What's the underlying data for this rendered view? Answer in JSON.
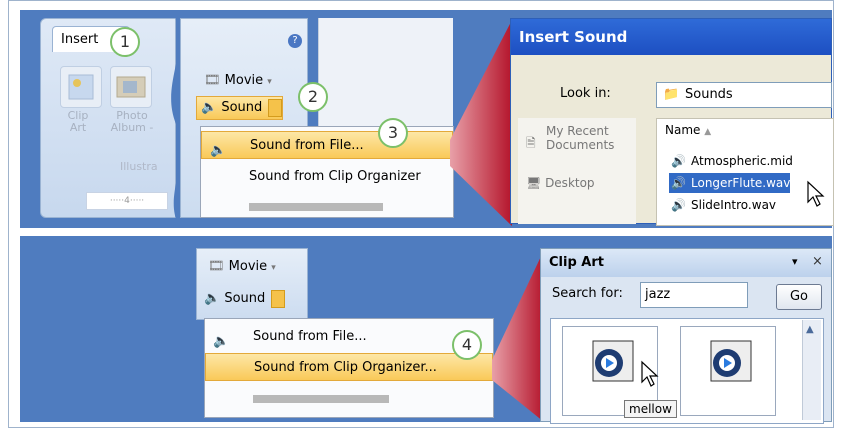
{
  "step_numbers": [
    "1",
    "2",
    "3",
    "4"
  ],
  "ribbon": {
    "tab_label": "Insert",
    "clip_art_label": "Clip\nArt",
    "photo_album_label": "Photo\nAlbum -",
    "group_label": "Illustra",
    "ruler_text": "·····4·····"
  },
  "media_group": {
    "movie_label": "Movie",
    "sound_label": "Sound"
  },
  "sound_menu": {
    "from_file": "Sound from File...",
    "from_clip_organizer": "Sound from Clip Organizer",
    "from_clip_organizer_2": "Sound from Clip Organizer..."
  },
  "insert_sound_dialog": {
    "title": "Insert Sound",
    "look_in_label": "Look in:",
    "look_in_value": "Sounds",
    "places": [
      "My Recent\nDocuments",
      "Desktop"
    ],
    "name_column": "Name",
    "files": [
      "Atmospheric.mid",
      "LongerFlute.wav",
      "SlideIntro.wav"
    ],
    "selected_index": 1
  },
  "clip_art": {
    "title": "Clip Art",
    "search_label": "Search for:",
    "search_value": "jazz",
    "go_label": "Go",
    "tooltip": "mellow"
  },
  "colors": {
    "band": "#4f7cbf",
    "highlight": "#f9c958",
    "wedge": "#c8283b",
    "dialog_title": "#1d4fc2",
    "selection": "#316ac5"
  }
}
